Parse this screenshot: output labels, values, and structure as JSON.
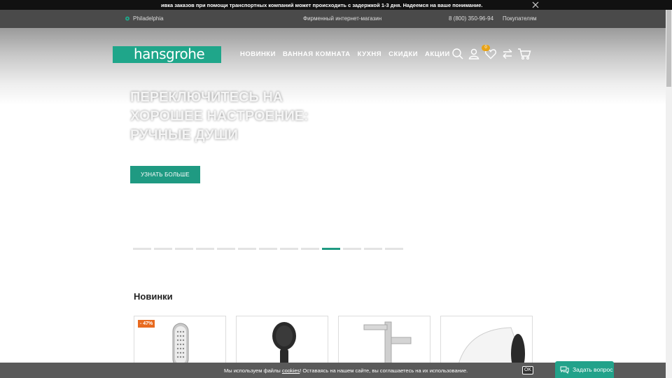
{
  "notice": {
    "text": "ивка заказов при помощи транспортных компаний может происходить с задержкой 1-3 дня. Надеемся на ваше понимание."
  },
  "topbar": {
    "city": "Philadelphia",
    "store": "Фирменный интернет-магазин",
    "phone": "8 (800) 350-96-94",
    "buyers": "Покупателям"
  },
  "header": {
    "logo": "hansgrohe",
    "nav": [
      "НОВИНКИ",
      "ВАННАЯ КОМНАТА",
      "КУХНЯ",
      "СКИДКИ",
      "АКЦИИ"
    ],
    "favorites_count": "0"
  },
  "hero": {
    "title": "ПЕРЕКЛЮЧИТЕСЬ НА ХОРОШЕЕ НАСТРОЕНИЕ: РУЧНЫЕ ДУШИ",
    "button": "УЗНАТЬ БОЛЬШЕ",
    "slides_total": 13,
    "active_slide": 10
  },
  "section": {
    "title": "Новинки"
  },
  "products": [
    {
      "discount": "- 47%"
    },
    {
      "discount": ""
    },
    {
      "discount": ""
    },
    {
      "discount": ""
    }
  ],
  "cookie": {
    "prefix": "Мы используем файлы ",
    "link": "cookies",
    "suffix": "! Оставаясь на нашем сайте, вы соглашаетесь на их использование.",
    "ok": "OK"
  },
  "chat": {
    "label": "Задать вопрос"
  },
  "colors": {
    "accent": "#1f9a82",
    "badge": "#e8a317",
    "discount": "#e86a1f"
  }
}
